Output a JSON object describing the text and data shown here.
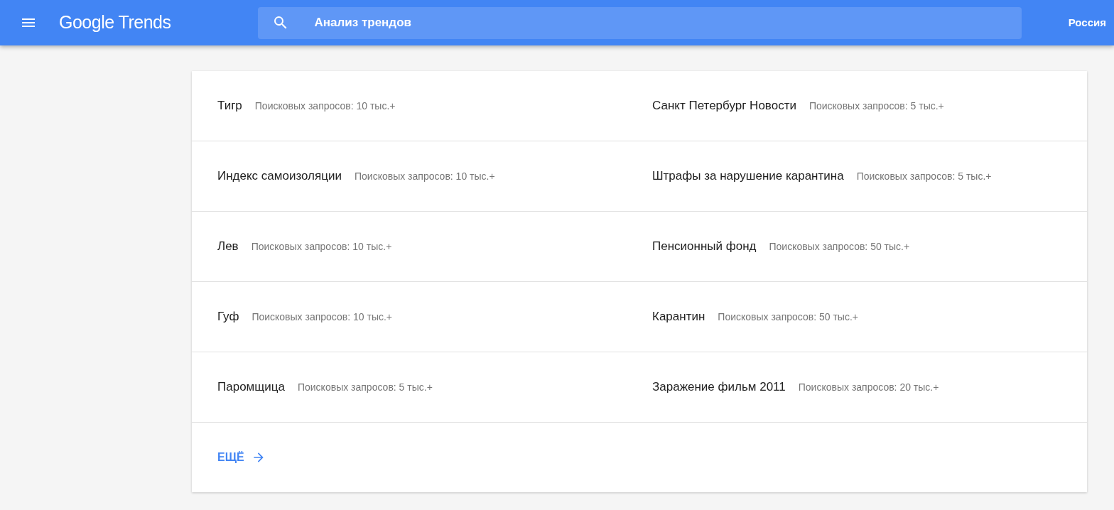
{
  "header": {
    "logo": "Google Trends",
    "search": {
      "value": "Анализ трендов"
    },
    "region": "Россия"
  },
  "trends": [
    {
      "title": "Тигр",
      "searches": "Поисковых запросов: 10 тыс.+"
    },
    {
      "title": "Санкт Петербург Новости",
      "searches": "Поисковых запросов: 5 тыс.+"
    },
    {
      "title": "Индекс самоизоляции",
      "searches": "Поисковых запросов: 10 тыс.+"
    },
    {
      "title": "Штрафы за нарушение карантина",
      "searches": "Поисковых запросов: 5 тыс.+"
    },
    {
      "title": "Лев",
      "searches": "Поисковых запросов: 10 тыс.+"
    },
    {
      "title": "Пенсионный фонд",
      "searches": "Поисковых запросов: 50 тыс.+"
    },
    {
      "title": "Гуф",
      "searches": "Поисковых запросов: 10 тыс.+"
    },
    {
      "title": "Карантин",
      "searches": "Поисковых запросов: 50 тыс.+"
    },
    {
      "title": "Паромщица",
      "searches": "Поисковых запросов: 5 тыс.+"
    },
    {
      "title": "Заражение фильм 2011",
      "searches": "Поисковых запросов: 20 тыс.+"
    }
  ],
  "more": "ЕЩЁ"
}
